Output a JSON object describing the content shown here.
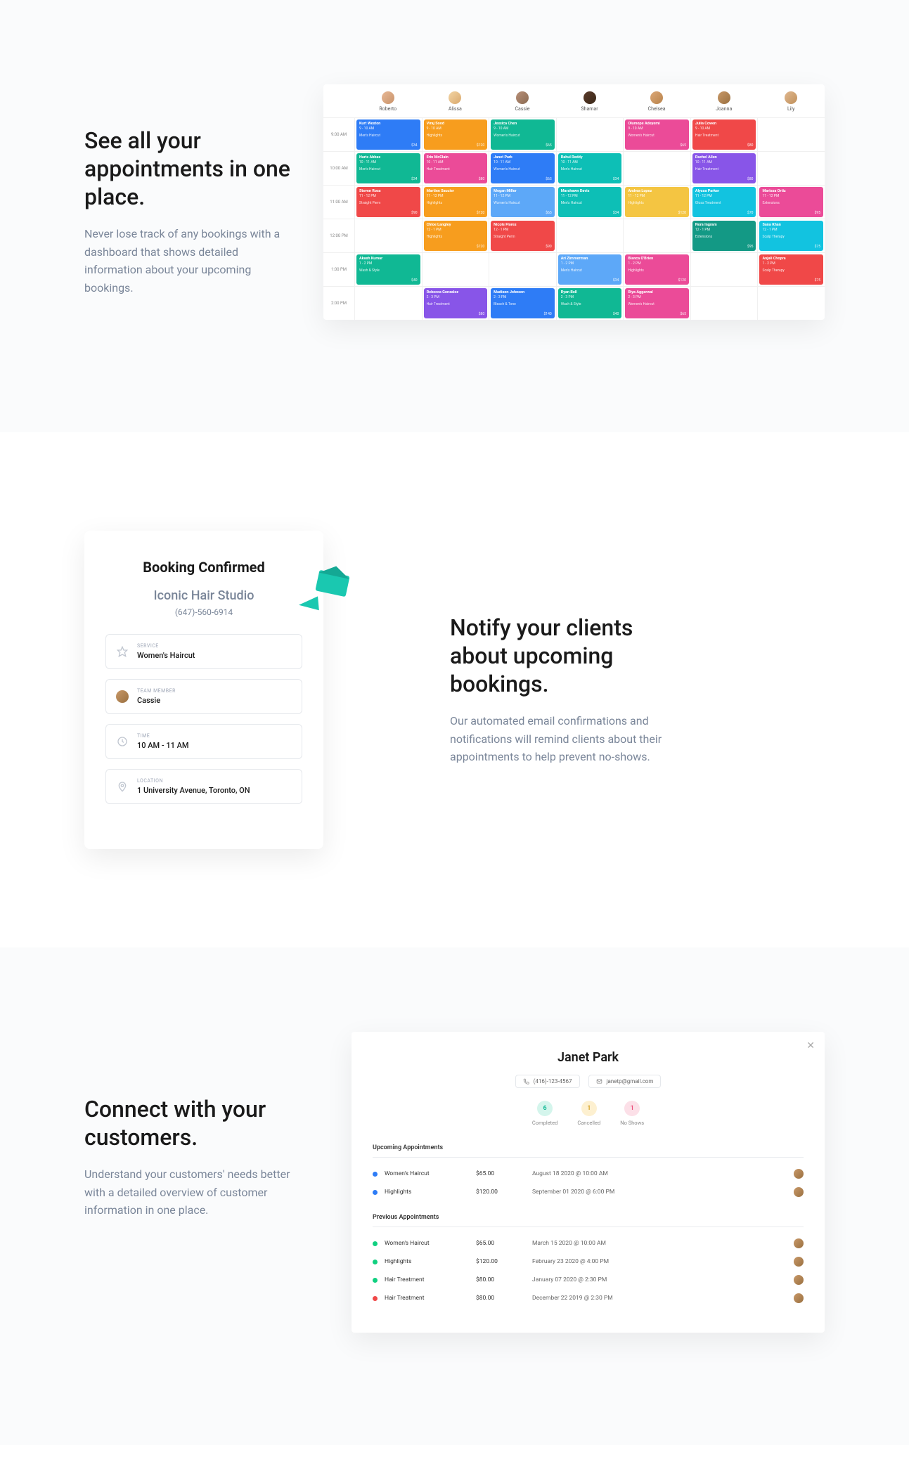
{
  "section1": {
    "heading": "See all your appointments in one place.",
    "description": "Never lose track of any bookings with a dashboard that shows detailed information about your upcoming bookings."
  },
  "calendar": {
    "staff": [
      "Roberto",
      "Alissa",
      "Cassie",
      "Shamar",
      "Chelsea",
      "Joanna",
      "Lily"
    ],
    "times": [
      "9:00 AM",
      "10:00 AM",
      "11:00 AM",
      "12:00 PM",
      "1:00 PM",
      "2:00 PM"
    ],
    "grid": [
      [
        {
          "t": "Kurt Weston",
          "tm": "9 - 10 AM",
          "s": "Men's Haircut",
          "p": "$34",
          "c": "c-blue"
        },
        {
          "t": "Viraj Sood",
          "tm": "9 - 10 AM",
          "s": "Highlights",
          "p": "$120",
          "c": "c-orange"
        },
        {
          "t": "Jessica Chen",
          "tm": "9 - 10 AM",
          "s": "Women's Haircut",
          "p": "$65",
          "c": "c-green"
        },
        null,
        {
          "t": "Olumope Adeyemi",
          "tm": "9 - 10 AM",
          "s": "Women's Haircut",
          "p": "$65",
          "c": "c-pink"
        },
        {
          "t": "Julia Cowen",
          "tm": "9 - 10 AM",
          "s": "Hair Treatment",
          "p": "$80",
          "c": "c-red"
        },
        null
      ],
      [
        {
          "t": "Haris Abbas",
          "tm": "10 - 11 AM",
          "s": "Men's Haircut",
          "p": "$34",
          "c": "c-green"
        },
        {
          "t": "Erin McClain",
          "tm": "10 - 11 AM",
          "s": "Hair Treatment",
          "p": "$80",
          "c": "c-pink"
        },
        {
          "t": "Janet Park",
          "tm": "10 - 11 AM",
          "s": "Women's Haircut",
          "p": "$65",
          "c": "c-blue"
        },
        {
          "t": "Rahul Reddy",
          "tm": "10 - 11 AM",
          "s": "Men's Haircut",
          "p": "$34",
          "c": "c-teal"
        },
        null,
        {
          "t": "Rachel Allen",
          "tm": "10 - 11 AM",
          "s": "Hair Treatment",
          "p": "$80",
          "c": "c-purple"
        },
        null
      ],
      [
        {
          "t": "Steven Ross",
          "tm": "11 - 12 PM",
          "s": "Straight Perm",
          "p": "$90",
          "c": "c-red"
        },
        {
          "t": "Martine Saucier",
          "tm": "11 - 12 PM",
          "s": "Highlights",
          "p": "$120",
          "c": "c-orange"
        },
        {
          "t": "Megan Miller",
          "tm": "11 - 12 PM",
          "s": "Women's Haircut",
          "p": "$65",
          "c": "c-lblue"
        },
        {
          "t": "Marshawn Davis",
          "tm": "11 - 12 PM",
          "s": "Men's Haircut",
          "p": "$34",
          "c": "c-teal"
        },
        {
          "t": "Andrea Lopez",
          "tm": "11 - 12 PM",
          "s": "Highlights",
          "p": "$120",
          "c": "c-yellow"
        },
        {
          "t": "Alyssa Parker",
          "tm": "11 - 12 PM",
          "s": "Gloss Treatment",
          "p": "$70",
          "c": "c-cyan"
        },
        {
          "t": "Marissa Ortiz",
          "tm": "11 - 12 PM",
          "s": "Extensions",
          "p": "$95",
          "c": "c-pink"
        }
      ],
      [
        null,
        {
          "t": "Chloe Langley",
          "tm": "12 - 1 PM",
          "s": "Highlights",
          "p": "$120",
          "c": "c-orange"
        },
        {
          "t": "Nicole Flores",
          "tm": "12 - 1 PM",
          "s": "Straight Perm",
          "p": "$90",
          "c": "c-red"
        },
        null,
        null,
        {
          "t": "Nora Ingram",
          "tm": "12 - 1 PM",
          "s": "Extensions",
          "p": "$95",
          "c": "c-dteal"
        },
        {
          "t": "Sana Khan",
          "tm": "12 - 1 PM",
          "s": "Scalp Therapy",
          "p": "$75",
          "c": "c-cyan"
        }
      ],
      [
        {
          "t": "Akash Kumar",
          "tm": "1 - 2 PM",
          "s": "Wash & Style",
          "p": "$40",
          "c": "c-green"
        },
        null,
        null,
        {
          "t": "Ari Zimmerman",
          "tm": "1 - 2 PM",
          "s": "Men's Haircut",
          "p": "$34",
          "c": "c-lblue"
        },
        {
          "t": "Bianca O'Brien",
          "tm": "1 - 2 PM",
          "s": "Highlights",
          "p": "$120",
          "c": "c-pink"
        },
        null,
        {
          "t": "Anjali Chopra",
          "tm": "1 - 2 PM",
          "s": "Scalp Therapy",
          "p": "$75",
          "c": "c-red"
        }
      ],
      [
        null,
        {
          "t": "Rebecca Gonzalez",
          "tm": "2 - 3 PM",
          "s": "Hair Treatment",
          "p": "$80",
          "c": "c-purple"
        },
        {
          "t": "Madison Johnson",
          "tm": "2 - 3 PM",
          "s": "Bleach & Tone",
          "p": "$140",
          "c": "c-blue"
        },
        {
          "t": "Ryan Bell",
          "tm": "2 - 3 PM",
          "s": "Wash & Style",
          "p": "$40",
          "c": "c-green"
        },
        {
          "t": "Riya Aggarwal",
          "tm": "2 - 3 PM",
          "s": "Women's Haircut",
          "p": "$65",
          "c": "c-pink"
        },
        null,
        null
      ]
    ]
  },
  "section2": {
    "heading": "Notify your clients about upcoming bookings.",
    "description": "Our automated email confirmations and notifications will remind clients about their appointments to help prevent no-shows."
  },
  "booking": {
    "title": "Booking Confirmed",
    "studio": "Iconic Hair Studio",
    "phone": "(647)-560-6914",
    "service_label": "SERVICE",
    "service_value": "Women's Haircut",
    "member_label": "TEAM MEMBER",
    "member_value": "Cassie",
    "time_label": "TIME",
    "time_value": "10 AM - 11 AM",
    "location_label": "LOCATION",
    "location_value": "1 University Avenue, Toronto, ON"
  },
  "section3": {
    "heading": "Connect with your customers.",
    "description": "Understand your customers' needs better with a detailed overview of customer information in one place."
  },
  "customer": {
    "name": "Janet Park",
    "phone": "(416)-123-4567",
    "email": "janetp@gmail.com",
    "stats": {
      "completed_n": "6",
      "completed_l": "Completed",
      "cancelled_n": "1",
      "cancelled_l": "Cancelled",
      "noshow_n": "1",
      "noshow_l": "No Shows"
    },
    "upcoming_title": "Upcoming Appointments",
    "previous_title": "Previous Appointments",
    "upcoming": [
      {
        "dot": "d-blue",
        "service": "Women's Haircut",
        "price": "$65.00",
        "date": "August 18 2020 @ 10:00 AM"
      },
      {
        "dot": "d-blue",
        "service": "Highlights",
        "price": "$120.00",
        "date": "September 01 2020 @ 6:00 PM"
      }
    ],
    "previous": [
      {
        "dot": "d-green",
        "service": "Women's Haircut",
        "price": "$65.00",
        "date": "March 15 2020 @ 10:00 AM"
      },
      {
        "dot": "d-green",
        "service": "Highlights",
        "price": "$120.00",
        "date": "February 23 2020 @ 4:00 PM"
      },
      {
        "dot": "d-green",
        "service": "Hair Treatment",
        "price": "$80.00",
        "date": "January 07 2020 @ 2:30 PM"
      },
      {
        "dot": "d-red",
        "service": "Hair Treatment",
        "price": "$80.00",
        "date": "December 22 2019 @ 2:30 PM"
      }
    ]
  }
}
